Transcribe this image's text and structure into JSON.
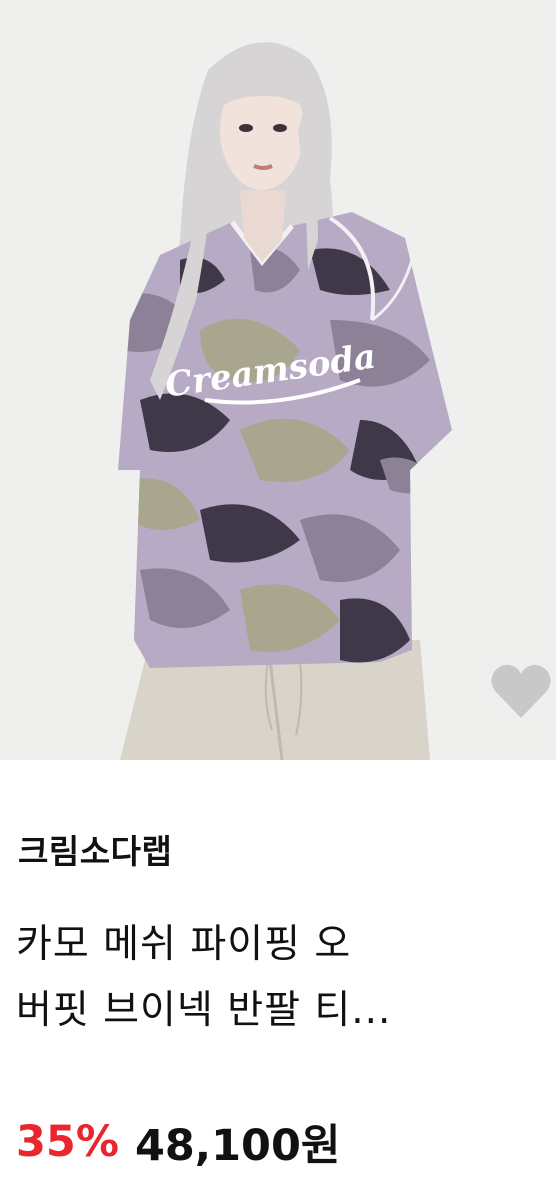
{
  "product": {
    "brand": "크림소다랩",
    "title_lines": [
      "카모 메쉬 파이핑 오",
      "버핏 브이넥 반팔 티..."
    ],
    "discount": "35%",
    "price": "48,100원",
    "print_text": "Creamsoda",
    "image": {
      "description_icon": "product-photo",
      "colors": {
        "background": "#efefee",
        "hair": "#d7d4d6",
        "camo_light": "#b7aac5",
        "camo_mid": "#8d8198",
        "camo_dark": "#3e3848",
        "camo_khaki": "#a9a68f",
        "pants": "#d9d4ca"
      }
    }
  },
  "wishlist": {
    "icon": "heart-icon",
    "color": "#c8c8c8"
  },
  "colors": {
    "discount": "#e8262c",
    "text": "#111111"
  }
}
